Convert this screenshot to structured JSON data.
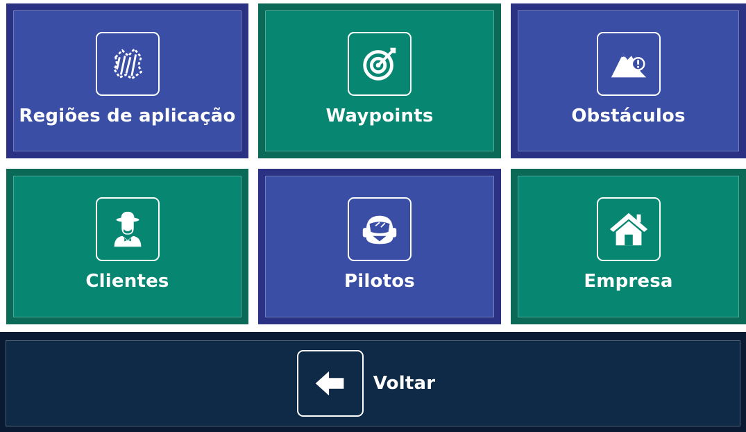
{
  "tiles": [
    {
      "label": "Regiões de aplicação",
      "icon": "map-region-icon"
    },
    {
      "label": "Waypoints",
      "icon": "target-icon"
    },
    {
      "label": "Obstáculos",
      "icon": "mountain-alert-icon"
    },
    {
      "label": "Clientes",
      "icon": "farmer-icon"
    },
    {
      "label": "Pilotos",
      "icon": "pilot-helmet-icon"
    },
    {
      "label": "Empresa",
      "icon": "house-icon"
    }
  ],
  "back": {
    "label": "Voltar",
    "icon": "arrow-left-icon"
  },
  "colors": {
    "blue": "#3a4ea5",
    "green": "#078771",
    "dark": "#0f2a47"
  }
}
